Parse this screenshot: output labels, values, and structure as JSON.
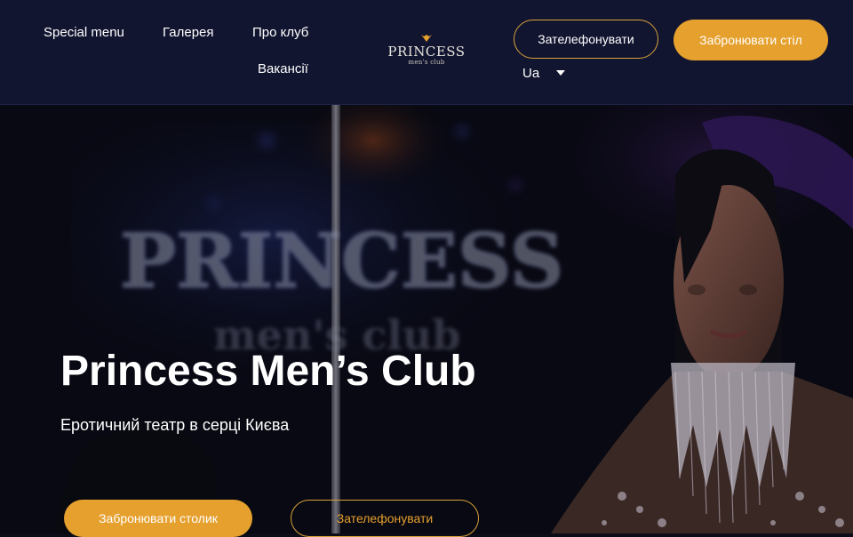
{
  "nav": {
    "items": [
      {
        "label": "Special menu"
      },
      {
        "label": "Галерея"
      },
      {
        "label": "Про клуб"
      },
      {
        "label": "Вакансії"
      }
    ]
  },
  "logo": {
    "name": "PRINCESS",
    "sub": "men's club",
    "icon": "crown-icon"
  },
  "header": {
    "call_label": "Зателефонувати",
    "book_label": "Забронювати стіл",
    "lang": "Ua",
    "lang_icon": "chevron-down-icon"
  },
  "hero": {
    "background_sign": [
      "PRINCESS",
      "men's club"
    ],
    "title": "Princess Men’s Club",
    "subtitle": "Еротичний театр в серці Києва",
    "book_label": "Забронювати столик",
    "call_label": "Зателефонувати"
  },
  "colors": {
    "accent": "#e6a02e",
    "header_bg": "#121530",
    "text": "#ffffff"
  }
}
